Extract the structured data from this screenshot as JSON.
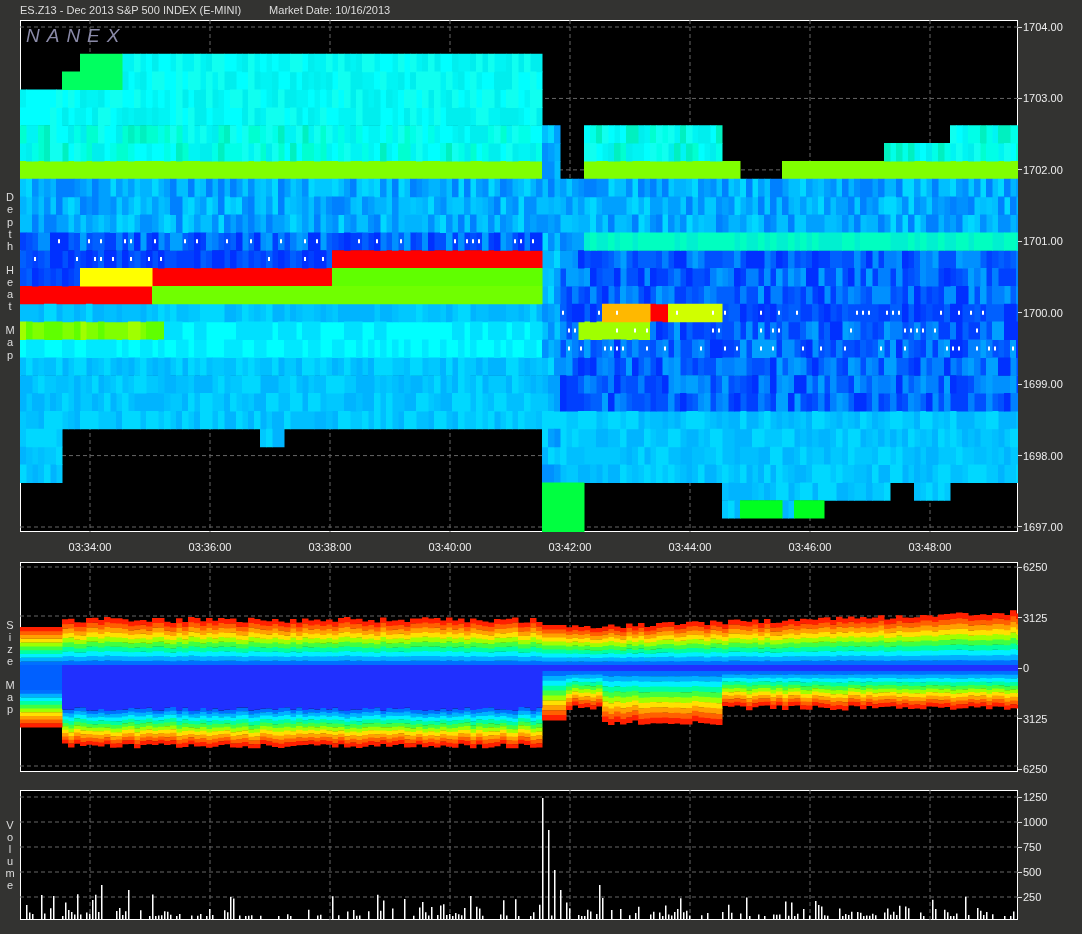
{
  "title": "ES.Z13 - Dec 2013 S&P 500 INDEX (E-MINI)",
  "market_date": "Market Date: 10/16/2013",
  "depth_panel": {
    "label": "Depth Heat Map",
    "logo": "NANEX",
    "price_ticks": [
      "1704.00",
      "1703.00",
      "1702.00",
      "1701.00",
      "1700.00",
      "1699.00",
      "1698.00",
      "1697.00"
    ],
    "time_ticks": [
      "03:34:00",
      "03:36:00",
      "03:38:00",
      "03:40:00",
      "03:42:00",
      "03:44:00",
      "03:46:00",
      "03:48:00"
    ]
  },
  "size_panel": {
    "label": "Size Map",
    "ticks": [
      "6250",
      "3125",
      "0",
      "3125",
      "6250"
    ]
  },
  "volume_panel": {
    "label": "Volume",
    "ticks": [
      "1250",
      "1000",
      "750",
      "500",
      "250"
    ]
  }
}
